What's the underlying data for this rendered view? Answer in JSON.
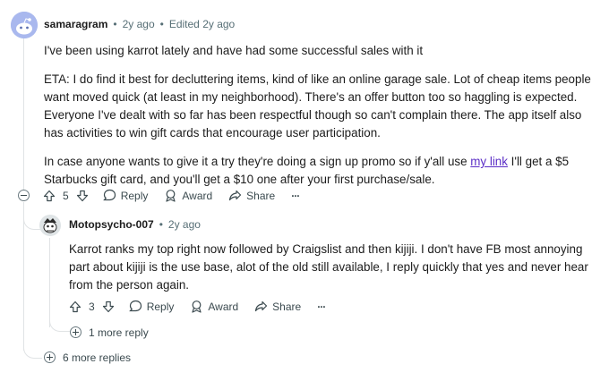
{
  "comment": {
    "username": "samaragram",
    "time": "2y ago",
    "edited": "Edited 2y ago",
    "para1": "I've been using karrot lately and have had some successful sales with it",
    "para2": "ETA: I do find it best for decluttering items, kind of like an online garage sale. Lot of cheap items people want moved quick (at least in my neighborhood). There's an offer button too so haggling is expected. Everyone I've dealt with so far has been respectful though so can't complain there. The app itself also has activities to win gift cards that encourage user participation.",
    "para3_before": "In case anyone wants to give it a try they're doing a sign up promo so if y'all use ",
    "para3_link": "my link",
    "para3_after": " I'll get a $5 Starbucks gift card, and you'll get a $10 one after your first purchase/sale.",
    "votes": "5",
    "reply_label": "Reply",
    "award_label": "Award",
    "share_label": "Share",
    "more_label": "···",
    "more_replies": "6 more replies"
  },
  "reply": {
    "username": "Motopsycho-007",
    "time": "2y ago",
    "text": "Karrot ranks my top right now followed by Craigslist and then kijiji. I don't have FB most annoying part about kijiji is the use base, alot of the old still available, I reply quickly that yes and never hear from the person again.",
    "votes": "3",
    "reply_label": "Reply",
    "award_label": "Award",
    "share_label": "Share",
    "more_label": "···",
    "more_reply": "1 more reply"
  },
  "separator": "•",
  "colors": {
    "link": "#5b2ec6",
    "text": "#1c1c1c",
    "meta": "#576f76",
    "line": "#e0e3e5"
  },
  "icons": [
    "reddit-avatar-icon",
    "upvote-icon",
    "downvote-icon",
    "reply-bubble-icon",
    "award-icon",
    "share-arrow-icon",
    "collapse-icon",
    "expand-plus-icon"
  ]
}
